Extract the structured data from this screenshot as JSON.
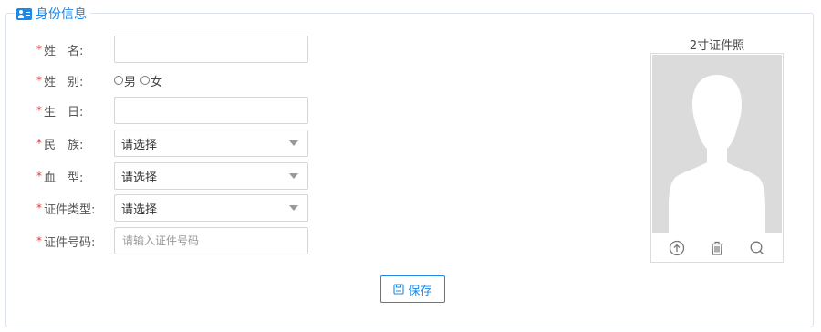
{
  "section": {
    "title": "身份信息",
    "icon": "id-card-icon",
    "accent": "#1e88e5"
  },
  "form": {
    "required_mark": "*",
    "name": {
      "label": "姓　名:",
      "value": ""
    },
    "gender": {
      "label": "姓　别:",
      "options": [
        "男",
        "女"
      ]
    },
    "birthday": {
      "label": "生　日:",
      "value": ""
    },
    "ethnicity": {
      "label": "民　族:",
      "value": "请选择"
    },
    "blood_type": {
      "label": "血　型:",
      "value": "请选择"
    },
    "id_type": {
      "label": "证件类型:",
      "value": "请选择"
    },
    "id_number": {
      "label": "证件号码:",
      "placeholder": "请输入证件号码",
      "value": ""
    }
  },
  "photo": {
    "title": "2寸证件照",
    "tools": [
      "upload-icon",
      "trash-icon",
      "search-icon"
    ]
  },
  "actions": {
    "save_label": "保存",
    "save_icon": "save-icon"
  }
}
